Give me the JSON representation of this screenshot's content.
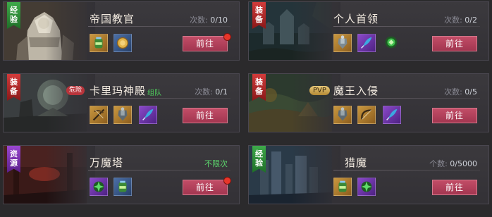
{
  "cards": [
    {
      "tag": [
        "经",
        "验"
      ],
      "title": "帝国教官",
      "count_label": "次数:",
      "count_value": "0/10",
      "button": "前往",
      "icons": [
        "exp-potion-icon",
        "gold-coin-icon"
      ]
    },
    {
      "tag": [
        "装",
        "备"
      ],
      "title": "个人首领",
      "count_label": "次数:",
      "count_value": "0/2",
      "button": "前往",
      "icons": [
        "armor-icon",
        "feather-icon",
        "green-gem-icon"
      ]
    },
    {
      "tag": [
        "装",
        "备"
      ],
      "title": "卡里玛神殿",
      "danger_badge": "危险",
      "team_badge": "组队",
      "count_label": "次数:",
      "count_value": "0/1",
      "button": "前往",
      "icons": [
        "crossbow-icon",
        "armor-icon",
        "feather-icon"
      ]
    },
    {
      "tag": [
        "装",
        "备"
      ],
      "title": "魔王入侵",
      "pvp_badge": "PVP",
      "count_label": "次数:",
      "count_value": "0/5",
      "button": "前往",
      "icons": [
        "armor-icon",
        "bow-icon",
        "feather-icon"
      ]
    },
    {
      "tag": [
        "资",
        "源"
      ],
      "title": "万魔塔",
      "count_text": "不限次",
      "button": "前往",
      "icons": [
        "green-gem-icon",
        "exp-potion-icon"
      ]
    },
    {
      "tag": [
        "经",
        "验"
      ],
      "title": "猎魔",
      "count_label": "个数:",
      "count_value": "0/5000",
      "button": "前往",
      "icons": [
        "exp-potion-icon",
        "green-gem-icon"
      ]
    }
  ],
  "colors": {
    "button": "#b0405b",
    "tag_green": "#2f8f3a",
    "tag_red": "#b52a2a",
    "tag_purple": "#7a34b0"
  }
}
